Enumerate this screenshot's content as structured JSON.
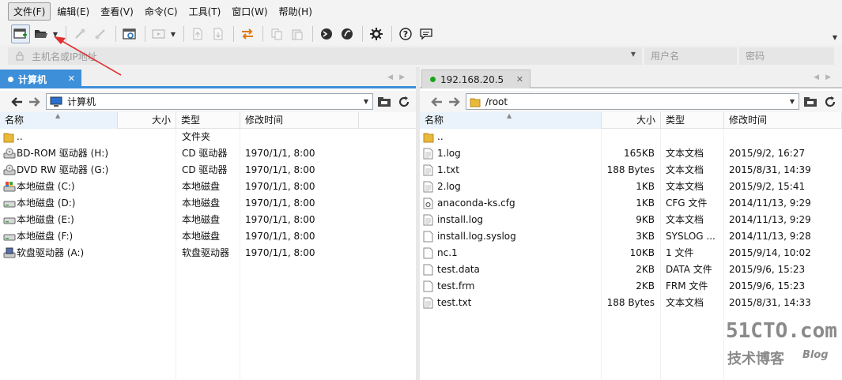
{
  "menu": [
    {
      "label": "文件(F)",
      "active": true
    },
    {
      "label": "编辑(E)"
    },
    {
      "label": "查看(V)"
    },
    {
      "label": "命令(C)"
    },
    {
      "label": "工具(T)"
    },
    {
      "label": "窗口(W)"
    },
    {
      "label": "帮助(H)"
    }
  ],
  "quickconnect": {
    "host_placeholder": "主机名或IP地址",
    "user_placeholder": "用户名",
    "password_placeholder": "密码"
  },
  "left": {
    "tab_label": "计算机",
    "path": "计算机",
    "columns": [
      "名称",
      "大小",
      "类型",
      "修改时间"
    ],
    "rows": [
      {
        "name": "..",
        "size": "",
        "type": "文件夹",
        "modified": "",
        "icon": "folder-up-icon"
      },
      {
        "name": "BD-ROM 驱动器 (H:)",
        "size": "",
        "type": "CD 驱动器",
        "modified": "1970/1/1, 8:00",
        "icon": "optical-drive-icon"
      },
      {
        "name": "DVD RW 驱动器 (G:)",
        "size": "",
        "type": "CD 驱动器",
        "modified": "1970/1/1, 8:00",
        "icon": "optical-drive-icon"
      },
      {
        "name": "本地磁盘 (C:)",
        "size": "",
        "type": "本地磁盘",
        "modified": "1970/1/1, 8:00",
        "icon": "system-disk-icon"
      },
      {
        "name": "本地磁盘 (D:)",
        "size": "",
        "type": "本地磁盘",
        "modified": "1970/1/1, 8:00",
        "icon": "hard-disk-icon"
      },
      {
        "name": "本地磁盘 (E:)",
        "size": "",
        "type": "本地磁盘",
        "modified": "1970/1/1, 8:00",
        "icon": "hard-disk-icon"
      },
      {
        "name": "本地磁盘 (F:)",
        "size": "",
        "type": "本地磁盘",
        "modified": "1970/1/1, 8:00",
        "icon": "hard-disk-icon"
      },
      {
        "name": "软盘驱动器 (A:)",
        "size": "",
        "type": "软盘驱动器",
        "modified": "1970/1/1, 8:00",
        "icon": "floppy-drive-icon"
      }
    ]
  },
  "right": {
    "tab_label": "192.168.20.5",
    "path": "/root",
    "columns": [
      "名称",
      "大小",
      "类型",
      "修改时间"
    ],
    "rows": [
      {
        "name": "..",
        "size": "",
        "type": "",
        "modified": "",
        "icon": "folder-up-icon"
      },
      {
        "name": "1.log",
        "size": "165KB",
        "type": "文本文档",
        "modified": "2015/9/2, 16:27",
        "icon": "text-file-icon"
      },
      {
        "name": "1.txt",
        "size": "188 Bytes",
        "type": "文本文档",
        "modified": "2015/8/31, 14:39",
        "icon": "text-file-icon"
      },
      {
        "name": "2.log",
        "size": "1KB",
        "type": "文本文档",
        "modified": "2015/9/2, 15:41",
        "icon": "text-file-icon"
      },
      {
        "name": "anaconda-ks.cfg",
        "size": "1KB",
        "type": "CFG 文件",
        "modified": "2014/11/13, 9:29",
        "icon": "config-file-icon"
      },
      {
        "name": "install.log",
        "size": "9KB",
        "type": "文本文档",
        "modified": "2014/11/13, 9:29",
        "icon": "text-file-icon"
      },
      {
        "name": "install.log.syslog",
        "size": "3KB",
        "type": "SYSLOG ...",
        "modified": "2014/11/13, 9:28",
        "icon": "blank-file-icon"
      },
      {
        "name": "nc.1",
        "size": "10KB",
        "type": "1 文件",
        "modified": "2015/9/14, 10:02",
        "icon": "blank-file-icon"
      },
      {
        "name": "test.data",
        "size": "2KB",
        "type": "DATA 文件",
        "modified": "2015/9/6, 15:23",
        "icon": "blank-file-icon"
      },
      {
        "name": "test.frm",
        "size": "2KB",
        "type": "FRM 文件",
        "modified": "2015/9/6, 15:23",
        "icon": "blank-file-icon"
      },
      {
        "name": "test.txt",
        "size": "188 Bytes",
        "type": "文本文档",
        "modified": "2015/8/31, 14:33",
        "icon": "text-file-icon"
      }
    ]
  },
  "watermark": {
    "main": "51CTO.com",
    "sub": "技术博客",
    "tag": "Blog"
  },
  "colors": {
    "accent": "#3c8fd8",
    "connected": "#1aa51a",
    "annotation": "#e03030"
  }
}
